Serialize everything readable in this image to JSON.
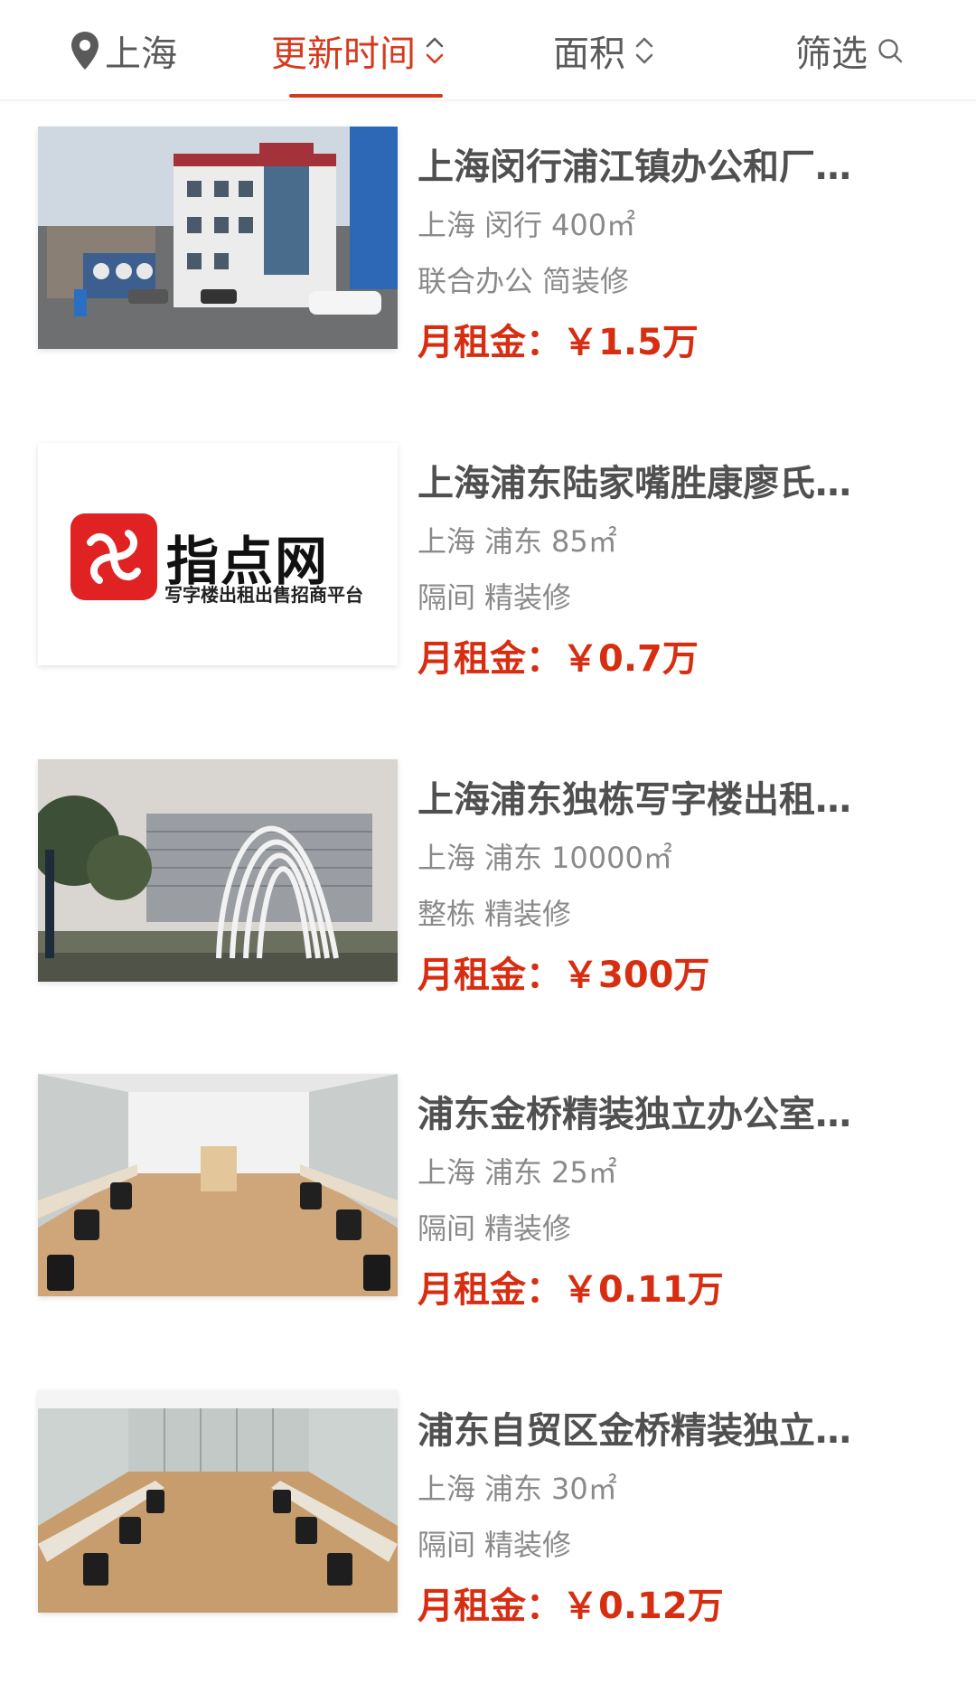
{
  "filter_bar": {
    "location": "上海",
    "sort_update": "更新时间",
    "sort_area": "面积",
    "filter": "筛选",
    "active_color": "#d63a1e"
  },
  "listings": [
    {
      "title": "上海闵行浦江镇办公和厂…",
      "city": "上海",
      "district": "闵行",
      "area": "400㎡",
      "tag1": "联合办公",
      "tag2": "简装修",
      "rent_label": "月租金：",
      "rent_value": "￥1.5万",
      "image": "building-exterior"
    },
    {
      "title": "上海浦东陆家嘴胜康廖氏…",
      "city": "上海",
      "district": "浦东",
      "area": "85㎡",
      "tag1": "隔间",
      "tag2": "精装修",
      "rent_label": "月租金：",
      "rent_value": "￥0.7万",
      "image": "zhidianwang-logo",
      "logo_text": "指点网",
      "logo_sub": "写字楼出租出售招商平台"
    },
    {
      "title": "上海浦东独栋写字楼出租…",
      "city": "上海",
      "district": "浦东",
      "area": "10000㎡",
      "tag1": "整栋",
      "tag2": "精装修",
      "rent_label": "月租金：",
      "rent_value": "￥300万",
      "image": "arch-sculpture"
    },
    {
      "title": "浦东金桥精装独立办公室…",
      "city": "上海",
      "district": "浦东",
      "area": "25㎡",
      "tag1": "隔间",
      "tag2": "精装修",
      "rent_label": "月租金：",
      "rent_value": "￥0.11万",
      "image": "office-room"
    },
    {
      "title": "浦东自贸区金桥精装独立…",
      "city": "上海",
      "district": "浦东",
      "area": "30㎡",
      "tag1": "隔间",
      "tag2": "精装修",
      "rent_label": "月租金：",
      "rent_value": "￥0.12万",
      "image": "office-room-glass"
    }
  ]
}
